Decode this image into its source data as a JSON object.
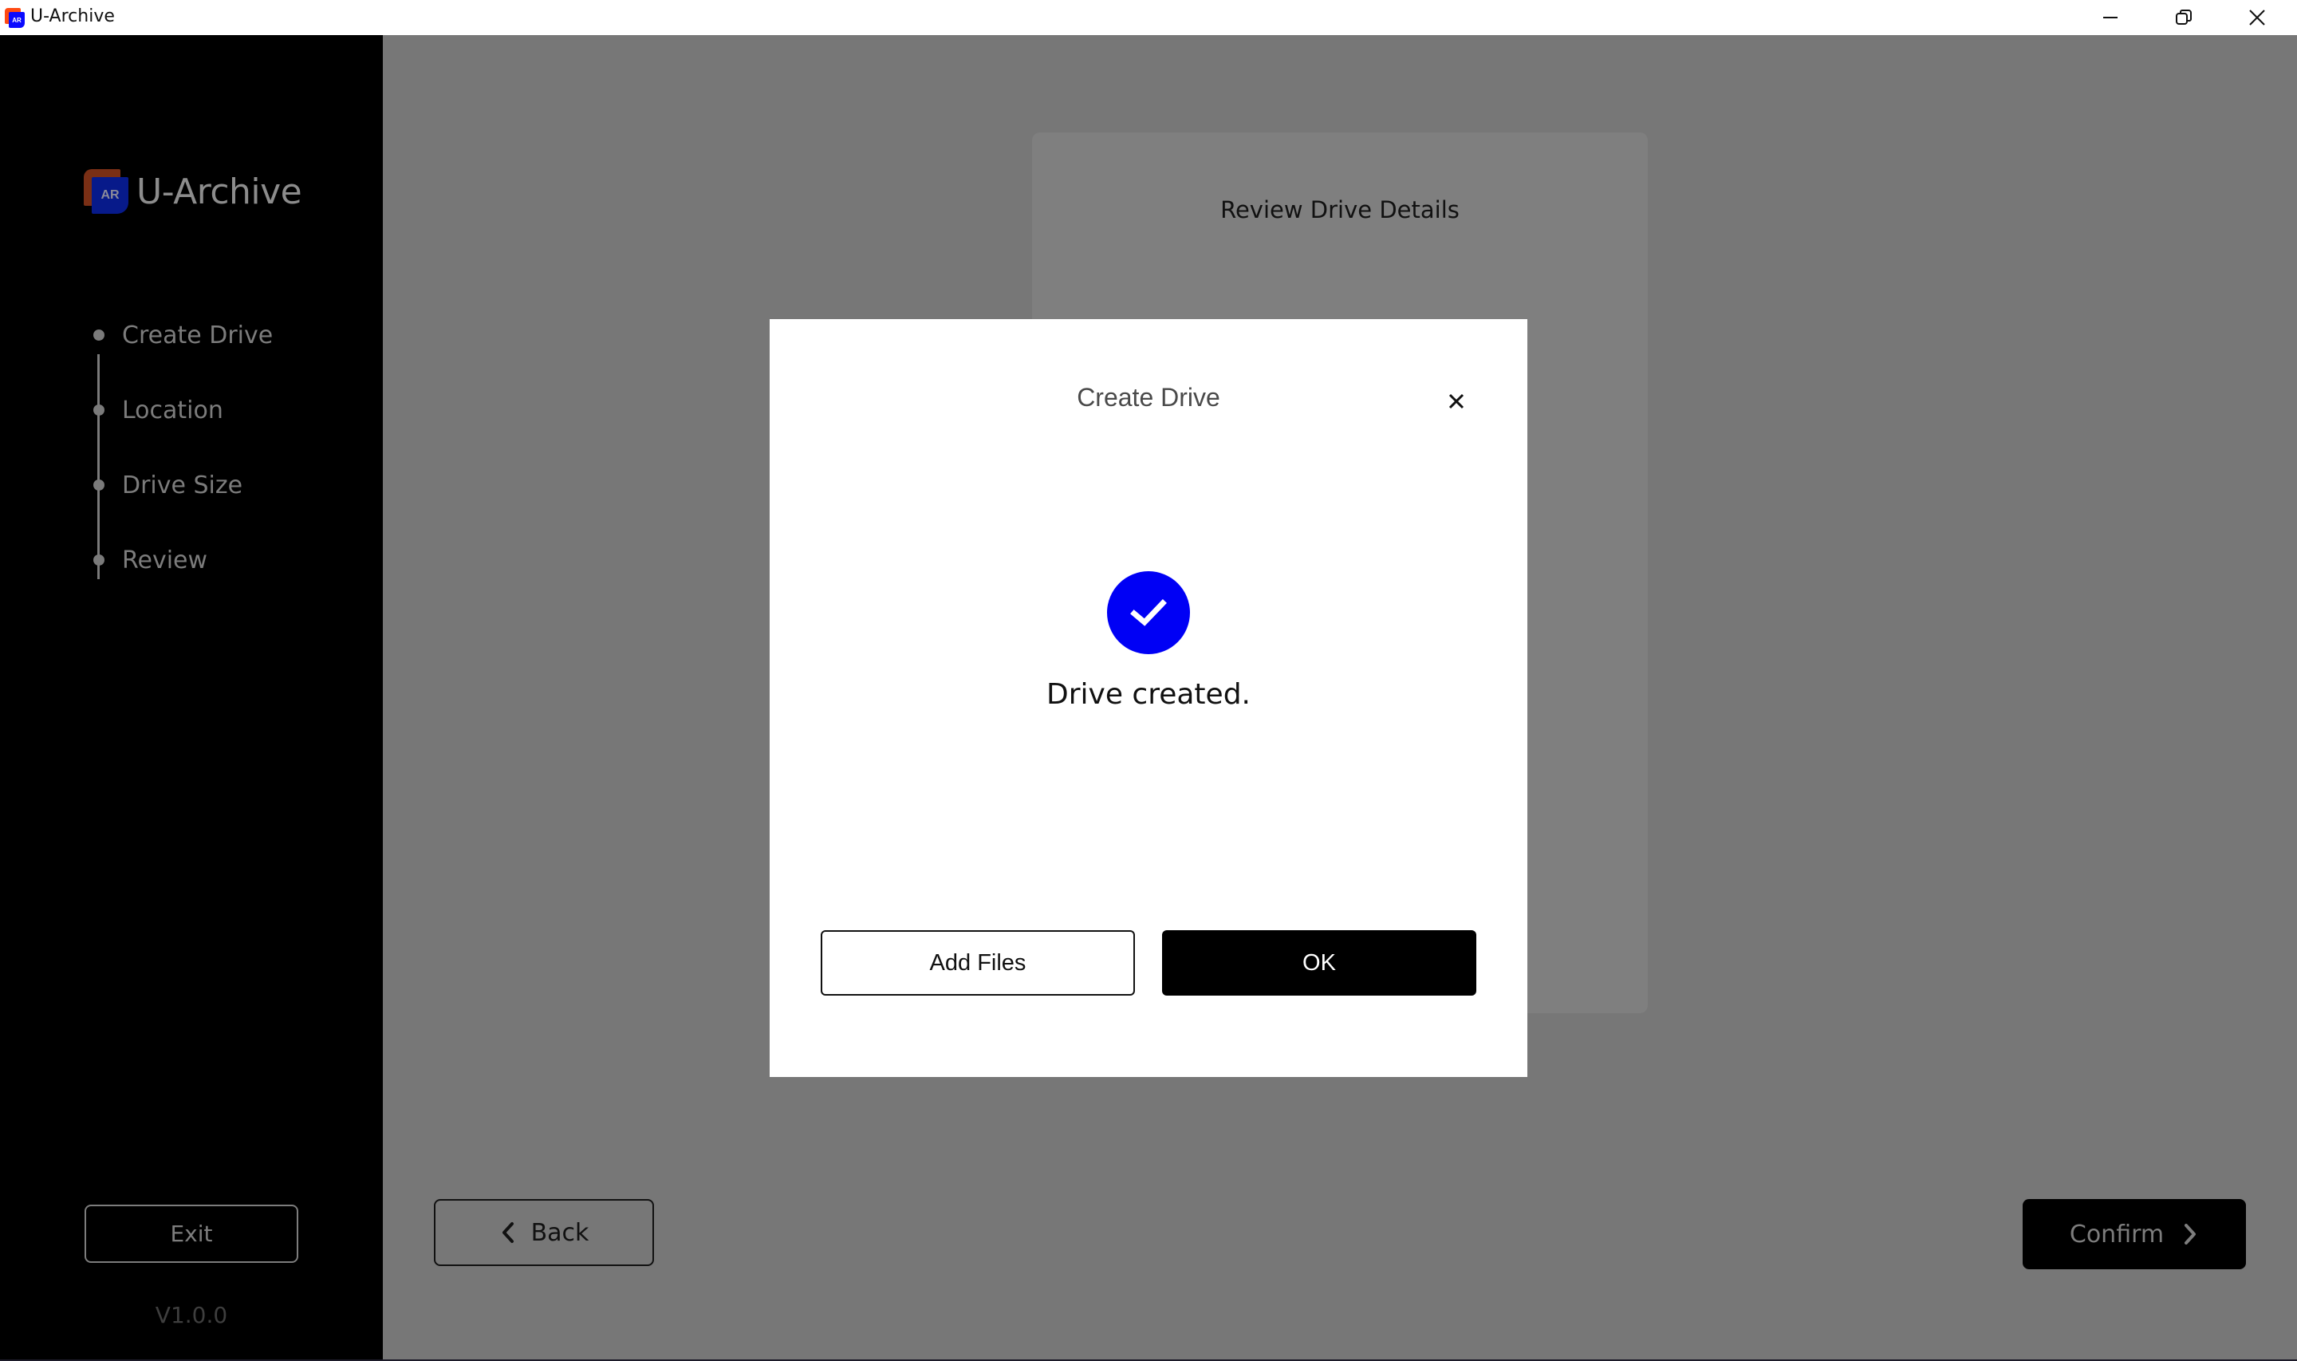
{
  "window": {
    "title": "U-Archive",
    "controls": [
      "minimize",
      "restore",
      "close"
    ]
  },
  "sidebar": {
    "logo_mark": "AR",
    "logo_text": "U-Archive",
    "steps": [
      {
        "label": "Create Drive"
      },
      {
        "label": "Location"
      },
      {
        "label": "Drive Size"
      },
      {
        "label": "Review"
      }
    ],
    "exit_label": "Exit",
    "version": "V1.0.0"
  },
  "main": {
    "review_card_title": "Review Drive Details",
    "back_label": "Back",
    "confirm_label": "Confirm"
  },
  "modal": {
    "title": "Create Drive",
    "message": "Drive created.",
    "add_files_label": "Add Files",
    "ok_label": "OK"
  },
  "colors": {
    "accent": "#0000f5",
    "sidebar_bg": "#000000",
    "overlay_bg": "#777777"
  }
}
